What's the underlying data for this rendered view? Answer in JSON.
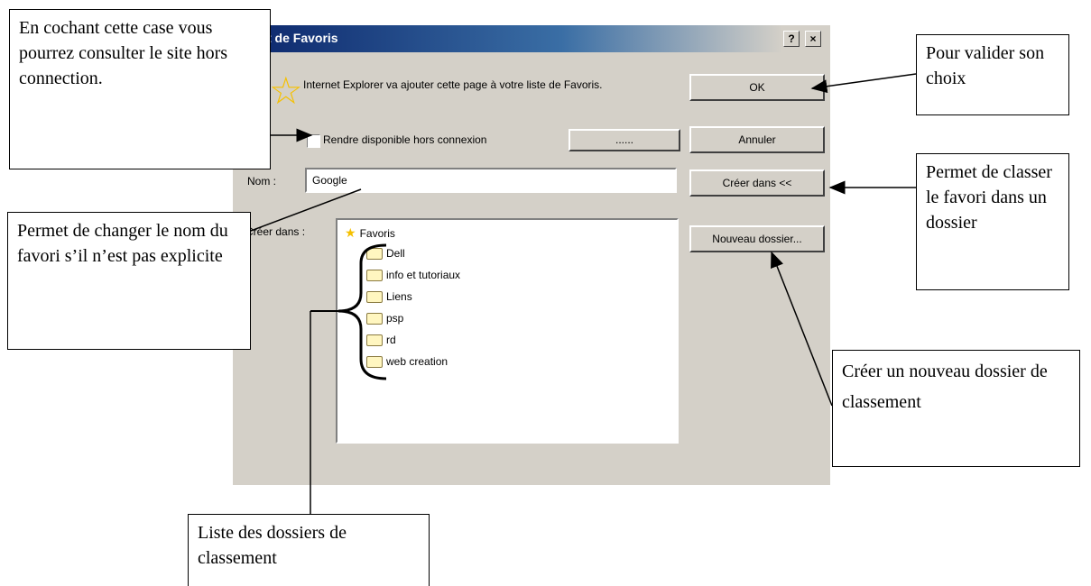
{
  "dialog": {
    "title": "t de Favoris",
    "help_label": "?",
    "close_label": "×",
    "intro_text": "Internet Explorer va ajouter cette page à votre liste de Favoris.",
    "offline_checkbox_label": "Rendre disponible hors connexion",
    "customize_label": "......",
    "name_label": "Nom :",
    "name_value": "Google",
    "create_in_label": "Créer dans :",
    "buttons": {
      "ok": "OK",
      "cancel": "Annuler",
      "create_in": "Créer dans <<",
      "new_folder": "Nouveau dossier..."
    },
    "tree": {
      "root": "Favoris",
      "folders": [
        "Dell",
        "info et tutoriaux",
        "Liens",
        "psp",
        "rd",
        "web creation"
      ]
    }
  },
  "callouts": {
    "offline": "En cochant cette case vous pourrez consulter le site hors connection.",
    "validate": "Pour valider son choix",
    "classify": "Permet de classer le favori dans un dossier",
    "rename": "Permet de changer le nom du favori s’il n’est pas explicite",
    "new_folder": "Créer un nouveau dossier de classement",
    "folder_list": "Liste des dossiers de classement"
  },
  "colors": {
    "dialog_bg": "#d4d0c8",
    "titlebar_start": "#0a246a",
    "favorite_star": "#f5c000"
  }
}
